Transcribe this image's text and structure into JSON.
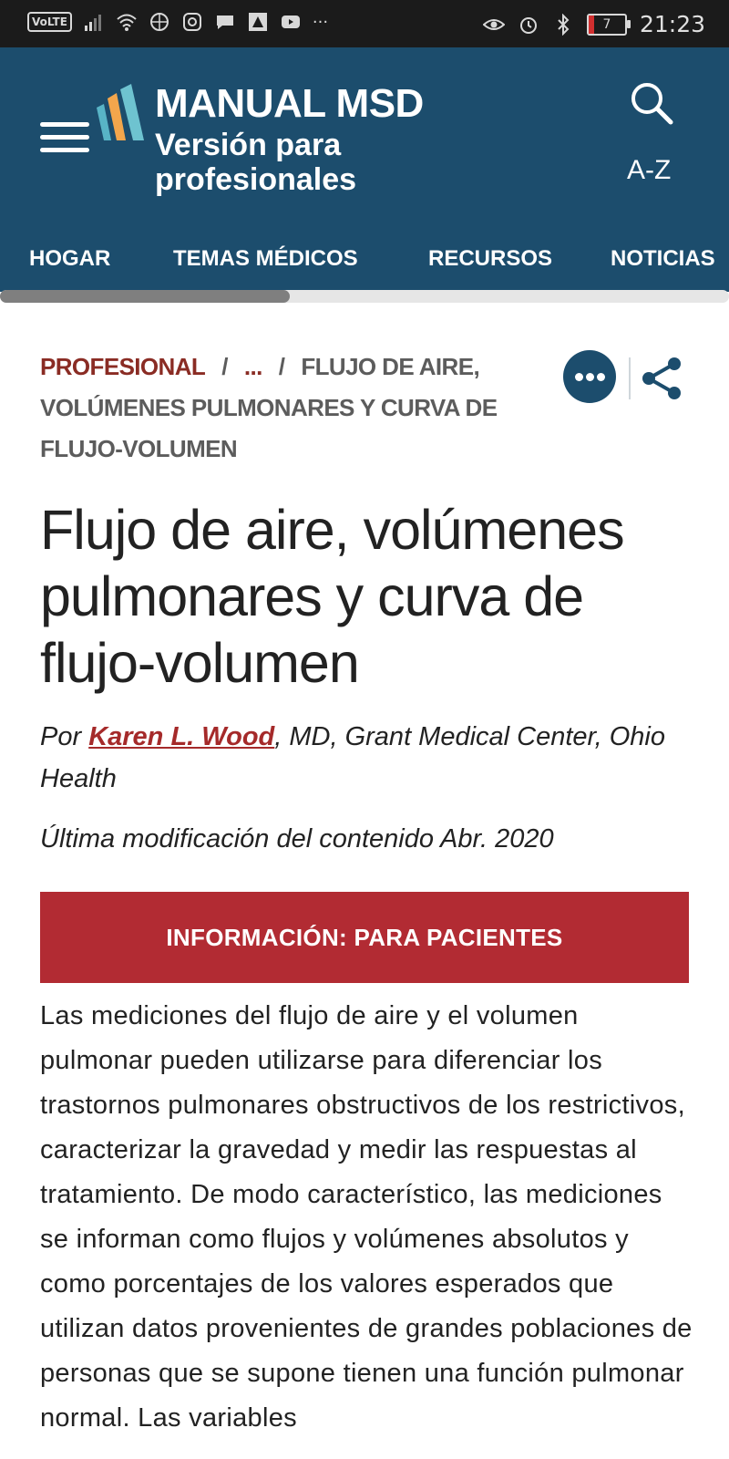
{
  "status_bar": {
    "network_badge": "VoLTE",
    "time": "21:23",
    "battery_level": "7",
    "more_notifications": "···"
  },
  "header": {
    "brand_title": "MANUAL MSD",
    "brand_subtitle": "Versión para profesionales",
    "az_label": "A-Z"
  },
  "nav": {
    "items": [
      "HOGAR",
      "TEMAS MÉDICOS",
      "RECURSOS",
      "NOTICIAS"
    ]
  },
  "breadcrumb": {
    "root": "PROFESIONAL",
    "separator": "/",
    "ellipsis": "...",
    "current": "FLUJO DE AIRE, VOLÚMENES PULMONARES Y CURVA DE FLUJO-VOLUMEN"
  },
  "article": {
    "title": "Flujo de aire, volúmenes pulmonares y curva de flujo-volumen",
    "by_prefix": "Por ",
    "author": "Karen L. Wood",
    "author_affiliation": ", MD, Grant Medical Center, Ohio Health",
    "modified": "Última modificación del contenido Abr. 2020",
    "patients_button": "INFORMACIÓN: PARA PACIENTES",
    "body": "Las mediciones del flujo de aire y el volumen pulmonar pueden utilizarse para diferenciar los trastornos pulmonares obstructivos de los restrictivos, caracterizar la gravedad y medir las respuestas al tratamiento. De modo característico, las mediciones se informan como flujos y volúmenes absolutos y como porcentajes de los valores esperados que utilizan datos provenientes de grandes poblaciones de personas que se supone tienen una función pulmonar normal. Las variables"
  },
  "colors": {
    "header_bg": "#1c4d6d",
    "accent_red": "#b22b33",
    "breadcrumb_red": "#8a2c24"
  },
  "icons": {
    "menu": "hamburger-icon",
    "search": "search-icon",
    "more": "more-icon",
    "share": "share-icon"
  }
}
